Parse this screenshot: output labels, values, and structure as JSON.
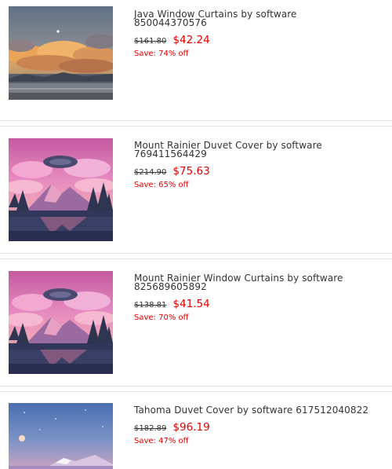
{
  "products": [
    {
      "title": "Java Window Curtains by software 850044370576",
      "old_price": "$161.80",
      "new_price": "$42.24",
      "save": "Save: 74% off",
      "image": "sunset-clouds-lake-pixel-art"
    },
    {
      "title": "Mount Rainier Duvet Cover by software 769411564429",
      "old_price": "$214.90",
      "new_price": "$75.63",
      "save": "Save: 65% off",
      "image": "pink-mountain-forest-pixel-art"
    },
    {
      "title": "Mount Rainier Window Curtains by software 825689605892",
      "old_price": "$138.81",
      "new_price": "$41.54",
      "save": "Save: 70% off",
      "image": "pink-mountain-forest-pixel-art"
    },
    {
      "title": "Tahoma Duvet Cover by software 617512040822",
      "old_price": "$182.89",
      "new_price": "$96.19",
      "save": "Save: 47% off",
      "image": "night-sky-moon-pixel-art"
    }
  ],
  "colors": {
    "sale_red": "#e80000",
    "text": "#333333",
    "divider": "#e2e2e2"
  }
}
